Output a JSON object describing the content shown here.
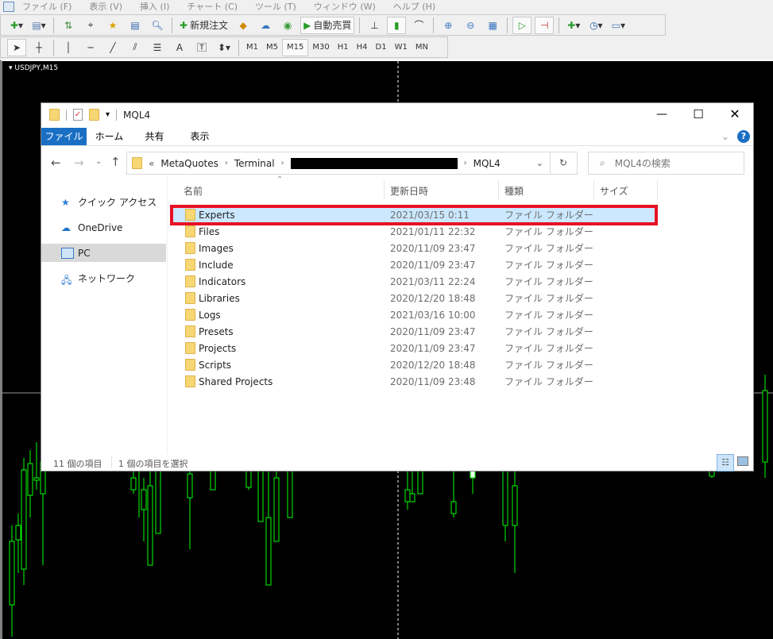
{
  "menu": [
    "ファイル (F)",
    "表示 (V)",
    "挿入 (I)",
    "チャート (C)",
    "ツール (T)",
    "ウィンドウ (W)",
    "ヘルプ (H)"
  ],
  "toolbar": {
    "new_order": "新規注文",
    "auto_trade": "自動売買"
  },
  "timeframes": [
    "M1",
    "M5",
    "M15",
    "M30",
    "H1",
    "H4",
    "D1",
    "W1",
    "MN"
  ],
  "active_timeframe": "M15",
  "chart": {
    "symbol_label": "USDJPY,M15",
    "candle_color": "#00ff00"
  },
  "explorer": {
    "title": "MQL4",
    "ribbon_tabs": [
      "ファイル",
      "ホーム",
      "共有",
      "表示"
    ],
    "address": {
      "prefix": "«",
      "parts": [
        "MetaQuotes",
        "Terminal",
        "MQL4"
      ]
    },
    "search_placeholder": "MQL4の検索",
    "nav": [
      "クイック アクセス",
      "OneDrive",
      "PC",
      "ネットワーク"
    ],
    "selected_nav": "PC",
    "columns": [
      "名前",
      "更新日時",
      "種類",
      "サイズ"
    ],
    "rows": [
      {
        "name": "Experts",
        "date": "2021/03/15 0:11",
        "type": "ファイル フォルダー",
        "selected": true
      },
      {
        "name": "Files",
        "date": "2021/01/11 22:32",
        "type": "ファイル フォルダー"
      },
      {
        "name": "Images",
        "date": "2020/11/09 23:47",
        "type": "ファイル フォルダー"
      },
      {
        "name": "Include",
        "date": "2020/11/09 23:47",
        "type": "ファイル フォルダー"
      },
      {
        "name": "Indicators",
        "date": "2021/03/11 22:24",
        "type": "ファイル フォルダー"
      },
      {
        "name": "Libraries",
        "date": "2020/12/20 18:48",
        "type": "ファイル フォルダー"
      },
      {
        "name": "Logs",
        "date": "2021/03/16 10:00",
        "type": "ファイル フォルダー"
      },
      {
        "name": "Presets",
        "date": "2020/11/09 23:47",
        "type": "ファイル フォルダー"
      },
      {
        "name": "Projects",
        "date": "2020/11/09 23:47",
        "type": "ファイル フォルダー"
      },
      {
        "name": "Scripts",
        "date": "2020/12/20 18:48",
        "type": "ファイル フォルダー"
      },
      {
        "name": "Shared Projects",
        "date": "2020/11/09 23:48",
        "type": "ファイル フォルダー"
      }
    ],
    "status": {
      "count": "11 個の項目",
      "selected": "1 個の項目を選択"
    },
    "highlight_color": "#e81123",
    "accent": "#1a6fc4"
  }
}
